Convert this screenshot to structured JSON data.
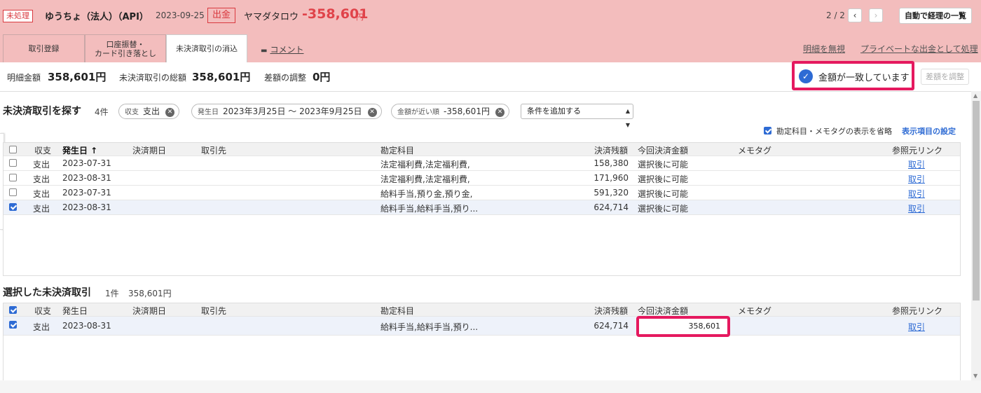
{
  "header": {
    "status_tag": "未処理",
    "account": "ゆうちょ（法人）（API）",
    "date": "2023-09-25",
    "direction": "出金",
    "payee": "ヤマダタロウ",
    "amount": "-358,601",
    "amount_unit": "円",
    "pager": "2 / 2",
    "prev_icon": "chevron-left-icon",
    "next_icon": "chevron-right-icon",
    "auto_list_button": "自動で経理の一覧",
    "accent_color": "#e0434a",
    "background_color": "#f3bdbd"
  },
  "tabs": [
    {
      "label": "取引登録",
      "active": false
    },
    {
      "label": "口座振替・\nカード引き落とし",
      "active": false
    },
    {
      "label": "未決済取引の消込",
      "active": true
    }
  ],
  "comment_link": "コメント",
  "ignore_link": "明細を無視",
  "private_link": "プライベートな出金として処理",
  "summary": {
    "detail_label": "明細金額",
    "detail_value": "358,601円",
    "total_label": "未決済取引の総額",
    "total_value": "358,601円",
    "diff_label": "差額の調整",
    "diff_value": "0円",
    "match_text": "金額が一致しています",
    "match_icon": "check-circle-icon",
    "adjust_button": "差額を調整"
  },
  "search": {
    "title": "未決済取引を探す",
    "count": "4件",
    "chips": [
      {
        "label": "収支",
        "value": "支出"
      },
      {
        "label": "発生日",
        "value": "2023年3月25日 〜 2023年9月25日"
      },
      {
        "label": "金額が近い順",
        "value": "-358,601円"
      }
    ],
    "add_condition": "条件を追加する",
    "omit_label": "勘定科目・メモタグの表示を省略",
    "display_settings": "表示項目の設定"
  },
  "columns": {
    "type": "収支",
    "date": "発生日",
    "date_sorted": "発生日 ↑",
    "due": "決済期日",
    "partner": "取引先",
    "account": "勘定科目",
    "balance": "決済残額",
    "current": "今回決済金額",
    "memo": "メモタグ",
    "ref": "参照元リンク"
  },
  "search_rows": [
    {
      "checked": false,
      "type": "支出",
      "date": "2023-07-31",
      "account": "法定福利費,法定福利費,",
      "balance": "158,380",
      "current": "選択後に可能",
      "ref": "取引"
    },
    {
      "checked": false,
      "type": "支出",
      "date": "2023-08-31",
      "account": "法定福利費,法定福利費,",
      "balance": "171,960",
      "current": "選択後に可能",
      "ref": "取引"
    },
    {
      "checked": false,
      "type": "支出",
      "date": "2023-07-31",
      "account": "給料手当,預り金,預り金,",
      "balance": "591,320",
      "current": "選択後に可能",
      "ref": "取引"
    },
    {
      "checked": true,
      "type": "支出",
      "date": "2023-08-31",
      "account": "給料手当,給料手当,預り...",
      "balance": "624,714",
      "current": "選択後に可能",
      "ref": "取引"
    }
  ],
  "selected": {
    "title": "選択した未決済取引",
    "count": "1件",
    "total": "358,601円",
    "rows": [
      {
        "checked": true,
        "type": "支出",
        "date": "2023-08-31",
        "account": "給料手当,給料手当,預り...",
        "balance": "624,714",
        "current": "358,601",
        "ref": "取引"
      }
    ]
  }
}
